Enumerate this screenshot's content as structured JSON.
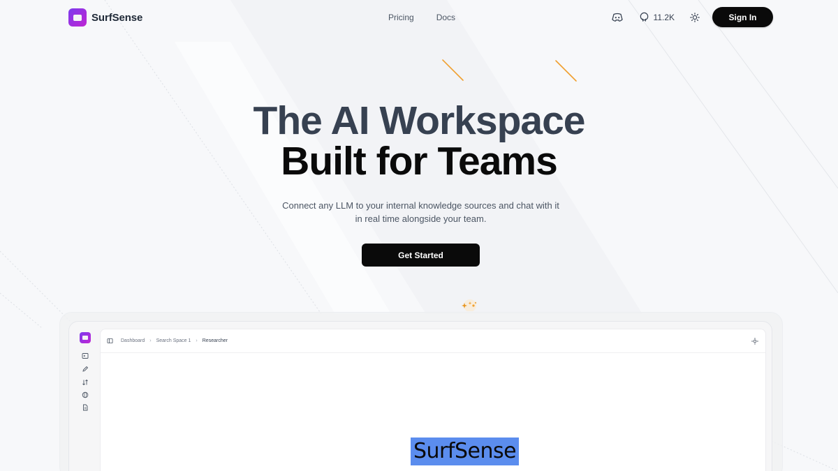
{
  "nav": {
    "brand": "SurfSense",
    "links": [
      "Pricing",
      "Docs"
    ],
    "github_stars": "11.2K",
    "signin_label": "Sign In",
    "icons": [
      "discord-icon",
      "github-icon",
      "sun-icon"
    ]
  },
  "hero": {
    "title_line1": "The AI Workspace",
    "title_line2": "Built for Teams",
    "subtitle": "Connect any LLM to your internal knowledge sources and chat with it in real time alongside your team.",
    "cta_label": "Get Started"
  },
  "preview": {
    "breadcrumb": [
      "Dashboard",
      "Search Space 1",
      "Researcher"
    ],
    "logo_word": "SurfSense",
    "sidebar_icons": [
      "terminal-icon",
      "edit-icon",
      "sort-icon",
      "globe-icon",
      "document-icon"
    ]
  },
  "colors": {
    "background": "#f7f8fa",
    "button": "#0a0a0a",
    "title_gray": "#374151",
    "highlight": "#5b8dee",
    "accent_orange": "#f0a030"
  }
}
